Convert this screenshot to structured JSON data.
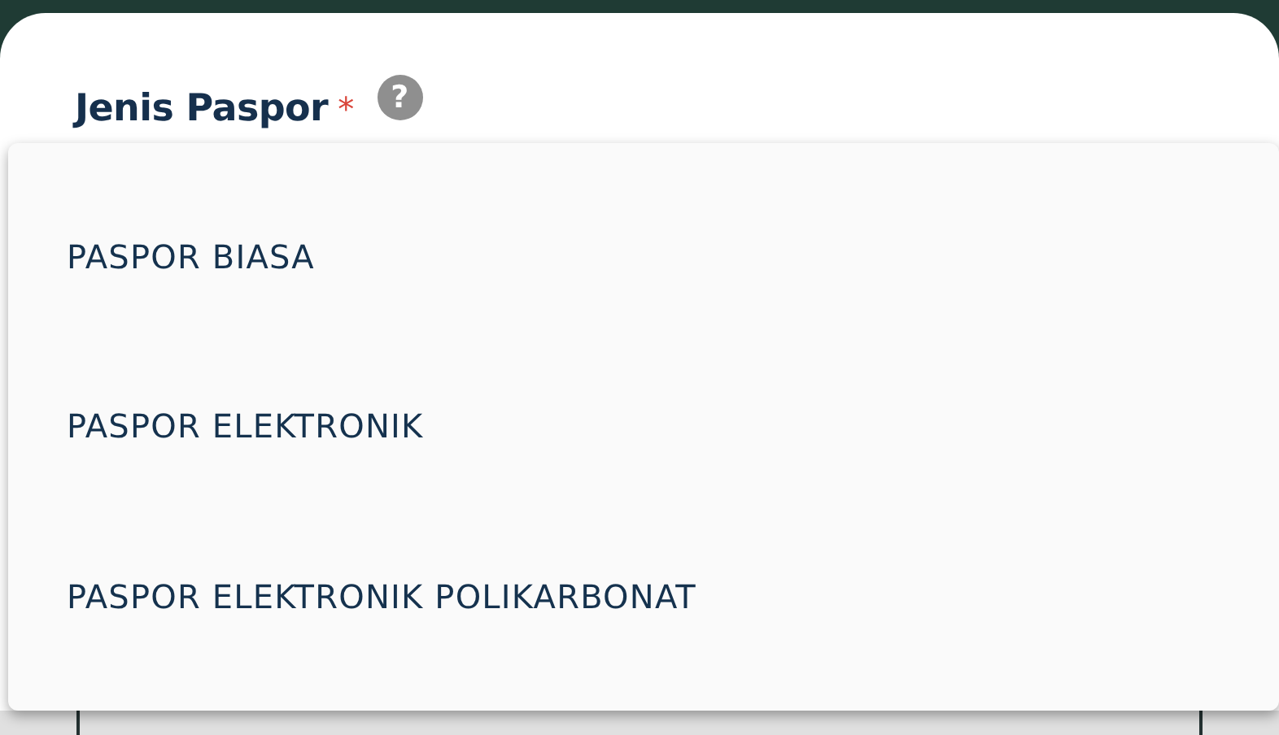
{
  "field": {
    "label": "Jenis Paspor",
    "required_mark": "*",
    "help_icon": "?"
  },
  "dropdown": {
    "open": true,
    "options": [
      "PASPOR BIASA",
      "PASPOR ELEKTRONIK",
      "PASPOR ELEKTRONIK POLIKARBONAT"
    ]
  }
}
